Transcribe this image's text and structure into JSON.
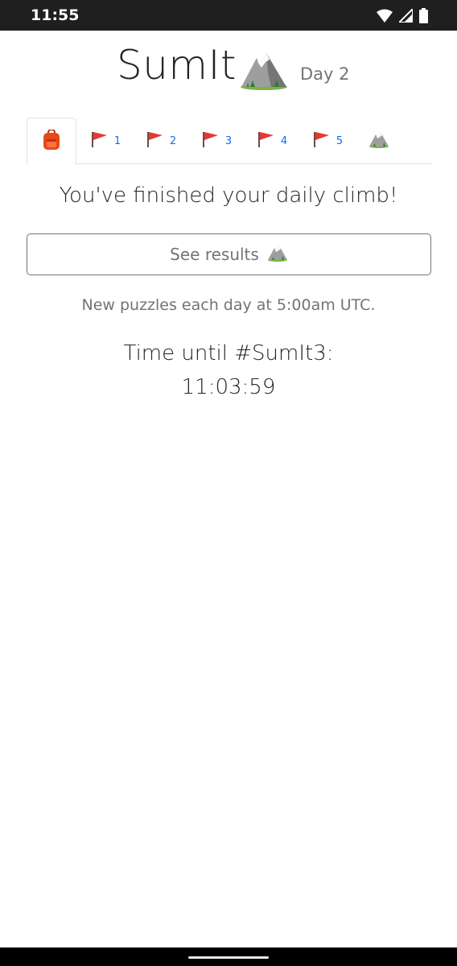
{
  "status_bar": {
    "time": "11:55",
    "icons": [
      "wifi-icon",
      "signal-icon",
      "battery-icon"
    ]
  },
  "header": {
    "title": "SumIt",
    "logo_icon": "mountain-icon",
    "day_label": "Day 2"
  },
  "tabs": [
    {
      "icon": "backpack-icon",
      "label": "",
      "active": true
    },
    {
      "icon": "red-flag-icon",
      "label": "1",
      "active": false
    },
    {
      "icon": "red-flag-icon",
      "label": "2",
      "active": false
    },
    {
      "icon": "red-flag-icon",
      "label": "3",
      "active": false
    },
    {
      "icon": "red-flag-icon",
      "label": "4",
      "active": false
    },
    {
      "icon": "red-flag-icon",
      "label": "5",
      "active": false
    },
    {
      "icon": "mountain-icon",
      "label": "",
      "active": false
    }
  ],
  "main": {
    "finished_text": "You've finished your daily climb!",
    "results_button_label": "See results",
    "new_puzzles_text": "New puzzles each day at 5:00am UTC.",
    "countdown_label": "Time until #SumIt3:",
    "countdown_time": "11:03:59"
  },
  "colors": {
    "status_bar_bg": "#1f1f1f",
    "link_blue": "#0d6efd",
    "muted_gray": "#6c757d",
    "flag_red": "#e53935"
  }
}
